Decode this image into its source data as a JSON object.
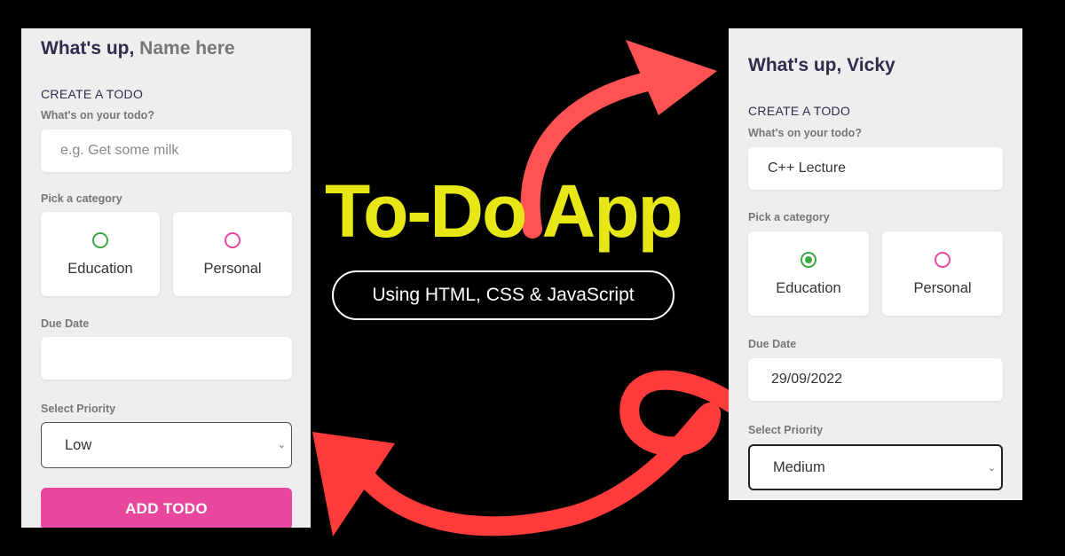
{
  "promo": {
    "title": "To-Do App",
    "subtitle": "Using HTML, CSS & JavaScript"
  },
  "left_app": {
    "greeting_prefix": "What's up,",
    "greeting_name": "Name here",
    "create_title": "CREATE A TODO",
    "todo_label": "What's on your todo?",
    "todo_placeholder": "e.g. Get some milk",
    "category_label": "Pick a category",
    "categories": [
      {
        "label": "Education",
        "selected": false,
        "color": "#3aa843"
      },
      {
        "label": "Personal",
        "selected": false,
        "color": "#e9479e"
      }
    ],
    "due_label": "Due Date",
    "due_value": "",
    "priority_label": "Select Priority",
    "priority_value": "Low",
    "add_button": "ADD TODO"
  },
  "right_app": {
    "greeting_prefix": "What's up,",
    "greeting_name": "Vicky",
    "create_title": "CREATE A TODO",
    "todo_label": "What's on your todo?",
    "todo_value": "C++ Lecture",
    "category_label": "Pick a category",
    "categories": [
      {
        "label": "Education",
        "selected": true,
        "color": "#3aa843"
      },
      {
        "label": "Personal",
        "selected": false,
        "color": "#e9479e"
      }
    ],
    "due_label": "Due Date",
    "due_value": "29/09/2022",
    "priority_label": "Select Priority",
    "priority_value": "Medium"
  },
  "colors": {
    "background": "#000000",
    "panel": "#eeeeee",
    "title_yellow": "#e7e716",
    "arrow_red": "#ff4a4a",
    "accent_pink": "#e9479e",
    "accent_green": "#3aa843"
  },
  "icons": [
    "chevron-down-icon",
    "curved-arrow-icon",
    "loop-arrow-icon"
  ]
}
